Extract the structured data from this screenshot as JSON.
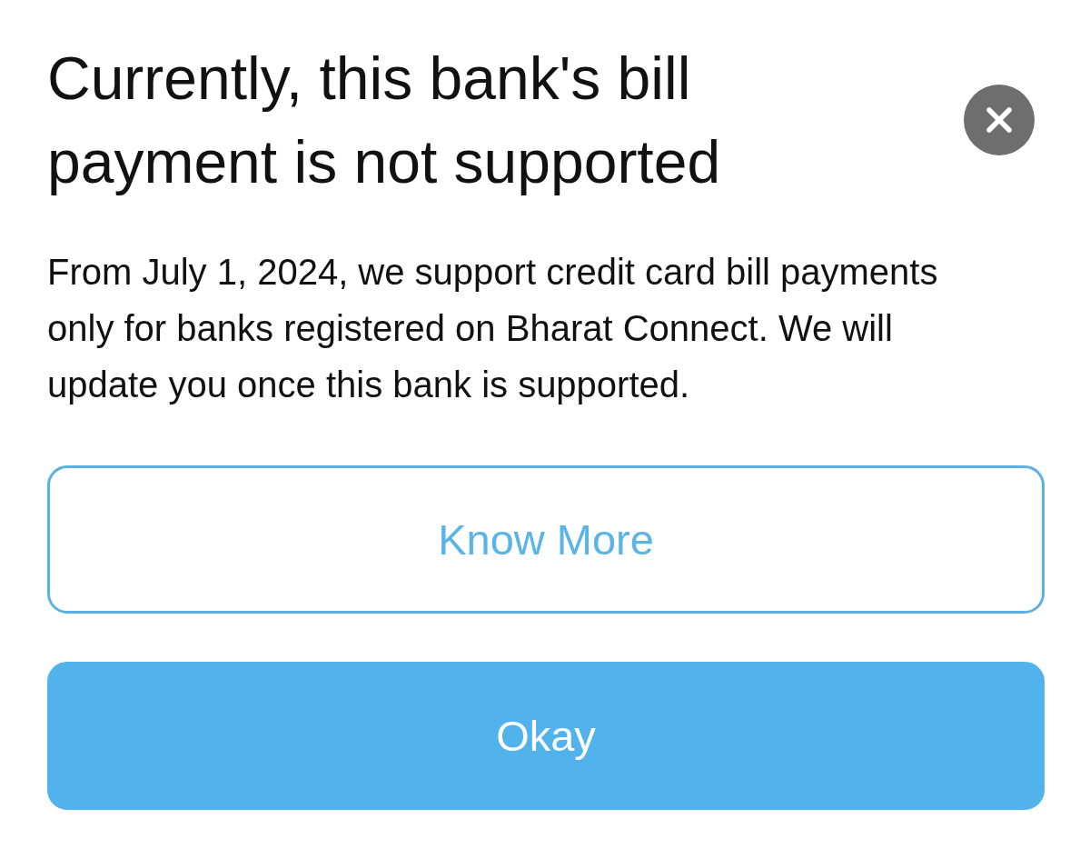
{
  "dialog": {
    "title": "Currently, this bank's bill payment is not supported",
    "message": "From July 1, 2024, we support credit card bill payments only for banks registered on Bharat Connect. We will update you once this bank is supported.",
    "buttons": [
      {
        "label": "Know More",
        "kind": "outline"
      },
      {
        "label": "Okay",
        "kind": "filled"
      }
    ]
  }
}
